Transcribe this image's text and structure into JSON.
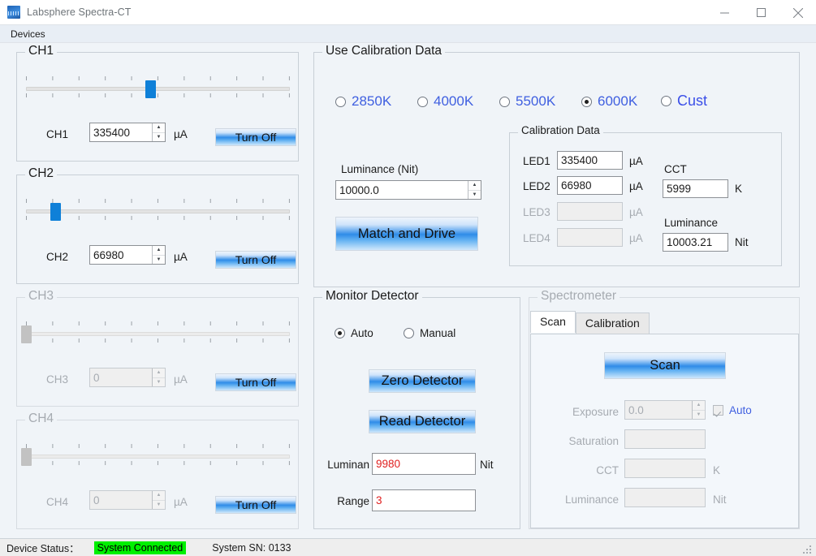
{
  "window": {
    "title": "Labsphere Spectra-CT",
    "icon": "app-icon",
    "minimize": "minimize-icon",
    "maximize": "maximize-icon",
    "close": "close-icon"
  },
  "menubar": {
    "items": [
      "Devices"
    ]
  },
  "channels": [
    {
      "group": "CH1",
      "label": "CH1",
      "value": "335400",
      "unit": "µA",
      "button": "Turn Off",
      "slider_pct": 47,
      "enabled": true
    },
    {
      "group": "CH2",
      "label": "CH2",
      "value": "66980",
      "unit": "µA",
      "button": "Turn Off",
      "slider_pct": 11,
      "enabled": true
    },
    {
      "group": "CH3",
      "label": "CH3",
      "value": "0",
      "unit": "µA",
      "button": "Turn Off",
      "slider_pct": 0,
      "enabled": false
    },
    {
      "group": "CH4",
      "label": "CH4",
      "value": "0",
      "unit": "µA",
      "button": "Turn Off",
      "slider_pct": 0,
      "enabled": false
    }
  ],
  "calibration": {
    "group_title": "Use Calibration Data",
    "presets": [
      {
        "label": "2850K",
        "selected": false
      },
      {
        "label": "4000K",
        "selected": false
      },
      {
        "label": "5500K",
        "selected": false
      },
      {
        "label": "6000K",
        "selected": true
      },
      {
        "label": "Cust",
        "selected": false
      }
    ],
    "luminance_label": "Luminance (Nit)",
    "luminance_value": "10000.0",
    "match_button": "Match and Drive",
    "data_group_title": "Calibration Data",
    "leds": [
      {
        "label": "LED1",
        "value": "335400",
        "unit": "µA",
        "enabled": true
      },
      {
        "label": "LED2",
        "value": "66980",
        "unit": "µA",
        "enabled": true
      },
      {
        "label": "LED3",
        "value": "",
        "unit": "µA",
        "enabled": false
      },
      {
        "label": "LED4",
        "value": "",
        "unit": "µA",
        "enabled": false
      }
    ],
    "cct_label": "CCT",
    "cct_value": "5999",
    "cct_unit": "K",
    "lum_label": "Luminance",
    "lum_value": "10003.21",
    "lum_unit": "Nit"
  },
  "monitor": {
    "group_title": "Monitor Detector",
    "mode_auto": "Auto",
    "mode_manual": "Manual",
    "mode_selected": "Auto",
    "zero_button": "Zero Detector",
    "read_button": "Read Detector",
    "luminance_label": "Luminan",
    "luminance_value": "9980",
    "luminance_unit": "Nit",
    "range_label": "Range",
    "range_value": "3"
  },
  "spectrometer": {
    "group_title": "Spectrometer",
    "enabled": false,
    "tabs": [
      {
        "label": "Scan",
        "active": true
      },
      {
        "label": "Calibration",
        "active": false
      }
    ],
    "scan_button": "Scan",
    "exposure_label": "Exposure",
    "exposure_value": "0.0",
    "auto_label": "Auto",
    "auto_checked": true,
    "saturation_label": "Saturation",
    "saturation_value": "",
    "cct_label": "CCT",
    "cct_value": "",
    "cct_unit": "K",
    "luminance_label": "Luminance",
    "luminance_value": "",
    "luminance_unit": "Nit"
  },
  "statusbar": {
    "device_status_label": "Device Status：",
    "connection_text": "System Connected",
    "connection_color": "#00f000",
    "serial_text": "System SN: 0133"
  }
}
